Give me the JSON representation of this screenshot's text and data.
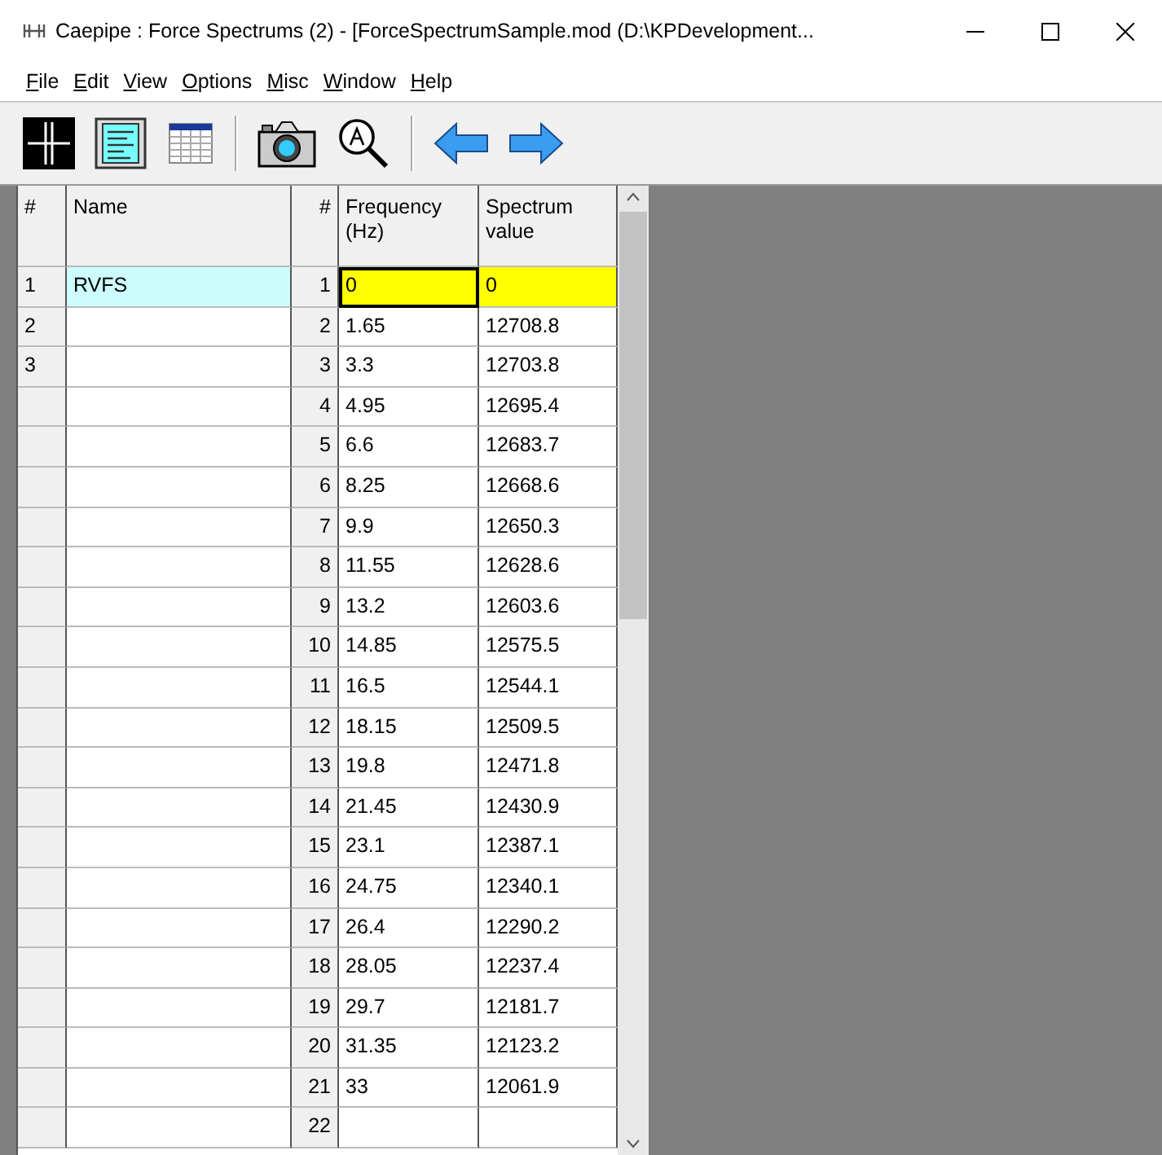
{
  "window": {
    "title": "Caepipe : Force Spectrums  (2)  -  [ForceSpectrumSample.mod (D:\\KPDevelopment..."
  },
  "menu": [
    "File",
    "Edit",
    "View",
    "Options",
    "Misc",
    "Window",
    "Help"
  ],
  "spectra_table": {
    "columns": [
      "#",
      "Name"
    ],
    "rows": [
      {
        "number": "1",
        "name": "RVFS",
        "selected": true
      },
      {
        "number": "2",
        "name": "",
        "selected": false
      },
      {
        "number": "3",
        "name": "",
        "selected": false
      }
    ]
  },
  "points_table": {
    "columns": [
      "#",
      "Frequency (Hz)",
      "Spectrum value"
    ],
    "rows": [
      {
        "number": "1",
        "frequency": "0",
        "value": "0",
        "selected": true
      },
      {
        "number": "2",
        "frequency": "1.65",
        "value": "12708.8",
        "selected": false
      },
      {
        "number": "3",
        "frequency": "3.3",
        "value": "12703.8",
        "selected": false
      },
      {
        "number": "4",
        "frequency": "4.95",
        "value": "12695.4",
        "selected": false
      },
      {
        "number": "5",
        "frequency": "6.6",
        "value": "12683.7",
        "selected": false
      },
      {
        "number": "6",
        "frequency": "8.25",
        "value": "12668.6",
        "selected": false
      },
      {
        "number": "7",
        "frequency": "9.9",
        "value": "12650.3",
        "selected": false
      },
      {
        "number": "8",
        "frequency": "11.55",
        "value": "12628.6",
        "selected": false
      },
      {
        "number": "9",
        "frequency": "13.2",
        "value": "12603.6",
        "selected": false
      },
      {
        "number": "10",
        "frequency": "14.85",
        "value": "12575.5",
        "selected": false
      },
      {
        "number": "11",
        "frequency": "16.5",
        "value": "12544.1",
        "selected": false
      },
      {
        "number": "12",
        "frequency": "18.15",
        "value": "12509.5",
        "selected": false
      },
      {
        "number": "13",
        "frequency": "19.8",
        "value": "12471.8",
        "selected": false
      },
      {
        "number": "14",
        "frequency": "21.45",
        "value": "12430.9",
        "selected": false
      },
      {
        "number": "15",
        "frequency": "23.1",
        "value": "12387.1",
        "selected": false
      },
      {
        "number": "16",
        "frequency": "24.75",
        "value": "12340.1",
        "selected": false
      },
      {
        "number": "17",
        "frequency": "26.4",
        "value": "12290.2",
        "selected": false
      },
      {
        "number": "18",
        "frequency": "28.05",
        "value": "12237.4",
        "selected": false
      },
      {
        "number": "19",
        "frequency": "29.7",
        "value": "12181.7",
        "selected": false
      },
      {
        "number": "20",
        "frequency": "31.35",
        "value": "12123.2",
        "selected": false
      },
      {
        "number": "21",
        "frequency": "33",
        "value": "12061.9",
        "selected": false
      },
      {
        "number": "22",
        "frequency": "",
        "value": "",
        "selected": false
      }
    ]
  }
}
